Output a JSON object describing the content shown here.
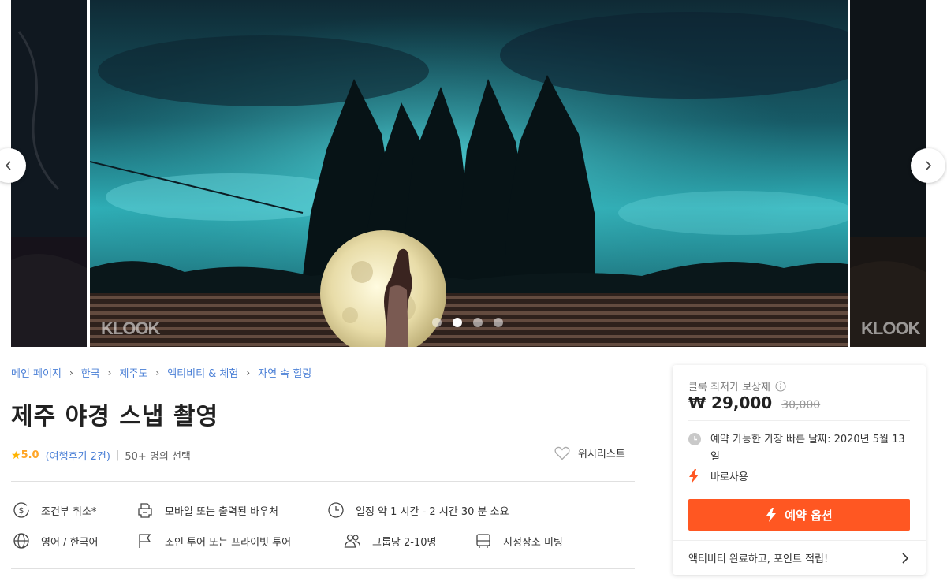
{
  "carousel": {
    "watermark": "KLOOK",
    "dots": [
      true,
      false,
      false,
      false
    ],
    "prev_icon": "chevron-left-icon",
    "next_icon": "chevron-right-icon"
  },
  "breadcrumb": {
    "items": [
      "메인 페이지",
      "한국",
      "제주도",
      "액티비티 & 체험",
      "자연 속 힐링"
    ]
  },
  "title": "제주 야경 스냅 촬영",
  "rating": {
    "value": "5.0",
    "reviews": "(여행후기 2건)",
    "booked": "50+ 명의 선택"
  },
  "wishlist": {
    "label": "위시리스트"
  },
  "features": [
    {
      "icon": "dollar-cancel-icon",
      "label": "조건부 취소*"
    },
    {
      "icon": "voucher-printer-icon",
      "label": "모바일 또는 출력된 바우처"
    },
    {
      "icon": "clock-icon",
      "label": "일정 약 1 시간 - 2 시간 30 분 소요"
    },
    {
      "icon": "globe-icon",
      "label": "영어 / 한국어"
    },
    {
      "icon": "flag-icon",
      "label": "조인 투어 또는 프라이빗 투어"
    },
    {
      "icon": "group-icon",
      "label": "그룹당 2-10명"
    },
    {
      "icon": "bus-icon",
      "label": "지정장소 미팅"
    }
  ],
  "booking": {
    "guarantee": "클룩 최저가 보상제",
    "price": "₩ 29,000",
    "original_price": "30,000",
    "earliest_date": "예약 가능한 가장 빠른 날짜: 2020년 5월 13일",
    "instant": "바로사용",
    "button": "예약 옵션",
    "points": "액티비티 완료하고, 포인트 적립!"
  },
  "colors": {
    "accent": "#ff5722",
    "link": "#4a7fd6",
    "star": "#ffb400"
  }
}
